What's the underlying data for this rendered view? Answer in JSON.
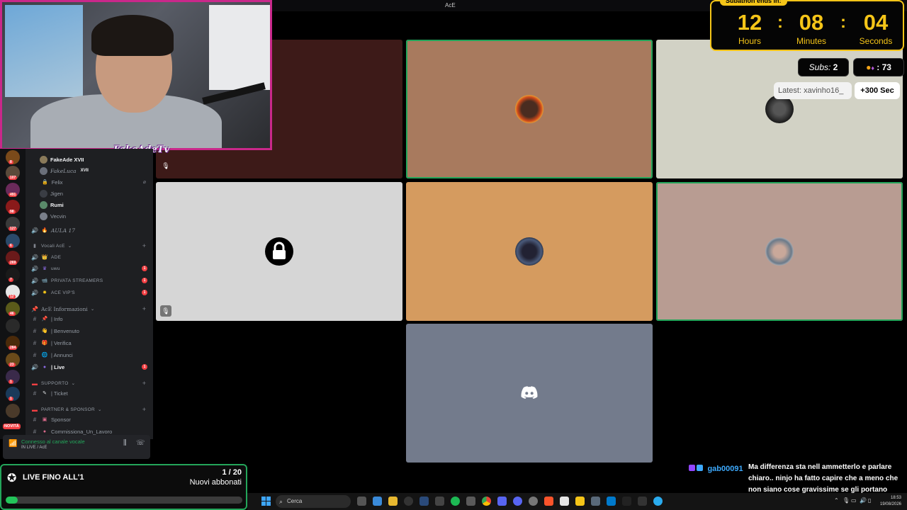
{
  "window": {
    "title": "AcE"
  },
  "webcam": {
    "streamer_name": "FakeAdeTv"
  },
  "voice_members": [
    {
      "name": "FakeAde XVII",
      "bright": true,
      "color": "#8a7a5a"
    },
    {
      "name": "FakeLuca",
      "tag": "XVII",
      "bright": false,
      "color": "#6a6f7a"
    },
    {
      "name": "Felix",
      "bright": false,
      "color": "#2b2d31",
      "lock": true
    },
    {
      "name": "Jigen",
      "bright": false,
      "color": "#3a3d44"
    },
    {
      "name": "Rumi",
      "bright": true,
      "color": "#5a8a6a"
    },
    {
      "name": "Vecvin",
      "bright": false,
      "color": "#7a7f8a"
    }
  ],
  "channels": {
    "aula": "AULA 17",
    "cat_vocali": "Vocali AcE",
    "vocali": [
      {
        "label": "ADE",
        "badge": ""
      },
      {
        "label": "uwu",
        "badge": "1"
      },
      {
        "label": "PRIVATA STREAMERS",
        "badge": "1"
      },
      {
        "label": "ACE VIP'S",
        "badge": "1"
      }
    ],
    "cat_info": "AcE Informazioni",
    "info": [
      {
        "label": "| Info",
        "icon": "#"
      },
      {
        "label": "| Benvenuto",
        "icon": "#"
      },
      {
        "label": "| Verifica",
        "icon": "#"
      },
      {
        "label": "| Annunci",
        "icon": "#"
      },
      {
        "label": "| Live",
        "icon": "#",
        "badge": "1",
        "active": true
      }
    ],
    "cat_supporto": "SUPPORTO",
    "supporto": [
      {
        "label": "| Ticket"
      }
    ],
    "cat_partner": "PARTNER & SPONSOR",
    "partner": [
      {
        "label": "Sponsor"
      },
      {
        "label": "Commissiona_Un_Lavoro"
      }
    ]
  },
  "server_badges": [
    "8",
    "107",
    "491",
    "98",
    "127",
    "6",
    "269",
    "7",
    "12",
    "46",
    "284",
    "23",
    "1",
    "1"
  ],
  "server_new_badge": "NOVITÀ",
  "voice_status": {
    "connected": "Connesso al canale vocale",
    "sub": "IN LIVE / AcE"
  },
  "subathon": {
    "title": "Subathon ends in:",
    "hours": "12",
    "minutes": "08",
    "seconds": "04",
    "hours_label": "Hours",
    "minutes_label": "Minutes",
    "seconds_label": "Seconds",
    "subs_label": "Subs:",
    "subs_value": "2",
    "bits_value": ": 73",
    "latest": "Latest: xavinho16_",
    "bonus": "+300 Sec"
  },
  "goal": {
    "title": "LIVE FINO ALL'1",
    "count": "1 / 20",
    "label": "Nuovi abbonati",
    "progress": 0.05
  },
  "chat": {
    "user": "gab00091",
    "message": "Ma differenza sta nell ammetterlo e parlare chiaro.. ninjo ha fatto capire che a meno che non siano cose gravissime se gli portano soldi le cose le fa"
  },
  "taskbar": {
    "search_placeholder": "Cerca",
    "time": "18:53",
    "date": "19/08/2026"
  },
  "colors": {
    "tile_dark_red": "#3d1a18",
    "tile_brown": "#a87a5e",
    "tile_cream": "#d2d2c5",
    "tile_light_gray": "#d6d6d6",
    "tile_orange": "#d59b5f",
    "tile_rose": "#b89c92",
    "tile_slate": "#737b8c",
    "accent_green": "#23a55a",
    "timer_yellow": "#f5c518"
  }
}
